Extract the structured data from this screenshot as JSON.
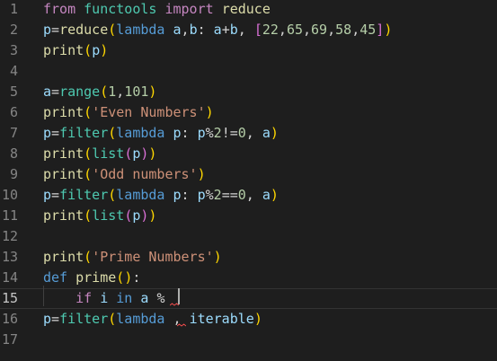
{
  "editor": {
    "colors": {
      "background": "#1e1e1e",
      "line_number": "#858585",
      "keyword": "#569cd6",
      "flow_keyword": "#c586c0",
      "function": "#dcdcaa",
      "string": "#ce9178",
      "number": "#b5cea8",
      "variable": "#9cdcfe",
      "error_squiggle": "#f14c4c"
    },
    "current_line": 15,
    "lines": [
      {
        "number": "1",
        "tokens": [
          {
            "t": "from",
            "c": "flow"
          },
          {
            "t": " ",
            "c": "plain"
          },
          {
            "t": "functools",
            "c": "module"
          },
          {
            "t": " ",
            "c": "plain"
          },
          {
            "t": "import",
            "c": "flow"
          },
          {
            "t": " ",
            "c": "plain"
          },
          {
            "t": "reduce",
            "c": "func"
          }
        ]
      },
      {
        "number": "2",
        "tokens": [
          {
            "t": "p",
            "c": "variable"
          },
          {
            "t": "=",
            "c": "plain"
          },
          {
            "t": "reduce",
            "c": "func"
          },
          {
            "t": "(",
            "c": "bracket1"
          },
          {
            "t": "lambda",
            "c": "keyword"
          },
          {
            "t": " ",
            "c": "plain"
          },
          {
            "t": "a",
            "c": "variable"
          },
          {
            "t": ",",
            "c": "plain"
          },
          {
            "t": "b",
            "c": "variable"
          },
          {
            "t": ": ",
            "c": "plain"
          },
          {
            "t": "a",
            "c": "variable"
          },
          {
            "t": "+",
            "c": "plain"
          },
          {
            "t": "b",
            "c": "variable"
          },
          {
            "t": ", ",
            "c": "plain"
          },
          {
            "t": "[",
            "c": "bracket2"
          },
          {
            "t": "22",
            "c": "number"
          },
          {
            "t": ",",
            "c": "plain"
          },
          {
            "t": "65",
            "c": "number"
          },
          {
            "t": ",",
            "c": "plain"
          },
          {
            "t": "69",
            "c": "number"
          },
          {
            "t": ",",
            "c": "plain"
          },
          {
            "t": "58",
            "c": "number"
          },
          {
            "t": ",",
            "c": "plain"
          },
          {
            "t": "45",
            "c": "number"
          },
          {
            "t": "]",
            "c": "bracket2"
          },
          {
            "t": ")",
            "c": "bracket1"
          }
        ]
      },
      {
        "number": "3",
        "tokens": [
          {
            "t": "print",
            "c": "func"
          },
          {
            "t": "(",
            "c": "bracket1"
          },
          {
            "t": "p",
            "c": "variable"
          },
          {
            "t": ")",
            "c": "bracket1"
          }
        ]
      },
      {
        "number": "4",
        "tokens": []
      },
      {
        "number": "5",
        "tokens": [
          {
            "t": "a",
            "c": "variable"
          },
          {
            "t": "=",
            "c": "plain"
          },
          {
            "t": "range",
            "c": "module"
          },
          {
            "t": "(",
            "c": "bracket1"
          },
          {
            "t": "1",
            "c": "number"
          },
          {
            "t": ",",
            "c": "plain"
          },
          {
            "t": "101",
            "c": "number"
          },
          {
            "t": ")",
            "c": "bracket1"
          }
        ]
      },
      {
        "number": "6",
        "tokens": [
          {
            "t": "print",
            "c": "func"
          },
          {
            "t": "(",
            "c": "bracket1"
          },
          {
            "t": "'Even Numbers'",
            "c": "string"
          },
          {
            "t": ")",
            "c": "bracket1"
          }
        ]
      },
      {
        "number": "7",
        "tokens": [
          {
            "t": "p",
            "c": "variable"
          },
          {
            "t": "=",
            "c": "plain"
          },
          {
            "t": "filter",
            "c": "module"
          },
          {
            "t": "(",
            "c": "bracket1"
          },
          {
            "t": "lambda",
            "c": "keyword"
          },
          {
            "t": " ",
            "c": "plain"
          },
          {
            "t": "p",
            "c": "variable"
          },
          {
            "t": ": ",
            "c": "plain"
          },
          {
            "t": "p",
            "c": "variable"
          },
          {
            "t": "%",
            "c": "plain"
          },
          {
            "t": "2",
            "c": "number"
          },
          {
            "t": "!=",
            "c": "plain"
          },
          {
            "t": "0",
            "c": "number"
          },
          {
            "t": ", ",
            "c": "plain"
          },
          {
            "t": "a",
            "c": "variable"
          },
          {
            "t": ")",
            "c": "bracket1"
          }
        ]
      },
      {
        "number": "8",
        "tokens": [
          {
            "t": "print",
            "c": "func"
          },
          {
            "t": "(",
            "c": "bracket1"
          },
          {
            "t": "list",
            "c": "module"
          },
          {
            "t": "(",
            "c": "bracket2"
          },
          {
            "t": "p",
            "c": "variable"
          },
          {
            "t": ")",
            "c": "bracket2"
          },
          {
            "t": ")",
            "c": "bracket1"
          }
        ]
      },
      {
        "number": "9",
        "tokens": [
          {
            "t": "print",
            "c": "func"
          },
          {
            "t": "(",
            "c": "bracket1"
          },
          {
            "t": "'Odd numbers'",
            "c": "string"
          },
          {
            "t": ")",
            "c": "bracket1"
          }
        ]
      },
      {
        "number": "10",
        "tokens": [
          {
            "t": "p",
            "c": "variable"
          },
          {
            "t": "=",
            "c": "plain"
          },
          {
            "t": "filter",
            "c": "module"
          },
          {
            "t": "(",
            "c": "bracket1"
          },
          {
            "t": "lambda",
            "c": "keyword"
          },
          {
            "t": " ",
            "c": "plain"
          },
          {
            "t": "p",
            "c": "variable"
          },
          {
            "t": ": ",
            "c": "plain"
          },
          {
            "t": "p",
            "c": "variable"
          },
          {
            "t": "%",
            "c": "plain"
          },
          {
            "t": "2",
            "c": "number"
          },
          {
            "t": "==",
            "c": "plain"
          },
          {
            "t": "0",
            "c": "number"
          },
          {
            "t": ", ",
            "c": "plain"
          },
          {
            "t": "a",
            "c": "variable"
          },
          {
            "t": ")",
            "c": "bracket1"
          }
        ]
      },
      {
        "number": "11",
        "tokens": [
          {
            "t": "print",
            "c": "func"
          },
          {
            "t": "(",
            "c": "bracket1"
          },
          {
            "t": "list",
            "c": "module"
          },
          {
            "t": "(",
            "c": "bracket2"
          },
          {
            "t": "p",
            "c": "variable"
          },
          {
            "t": ")",
            "c": "bracket2"
          },
          {
            "t": ")",
            "c": "bracket1"
          }
        ]
      },
      {
        "number": "12",
        "tokens": []
      },
      {
        "number": "13",
        "tokens": [
          {
            "t": "print",
            "c": "func"
          },
          {
            "t": "(",
            "c": "bracket1"
          },
          {
            "t": "'Prime Numbers'",
            "c": "string"
          },
          {
            "t": ")",
            "c": "bracket1"
          }
        ]
      },
      {
        "number": "14",
        "tokens": [
          {
            "t": "def",
            "c": "keyword"
          },
          {
            "t": " ",
            "c": "plain"
          },
          {
            "t": "prime",
            "c": "func"
          },
          {
            "t": "(",
            "c": "bracket1"
          },
          {
            "t": ")",
            "c": "bracket1"
          },
          {
            "t": ":",
            "c": "plain"
          }
        ]
      },
      {
        "number": "15",
        "tokens": [
          {
            "t": "    ",
            "c": "plain"
          },
          {
            "t": "if",
            "c": "flow"
          },
          {
            "t": " ",
            "c": "plain"
          },
          {
            "t": "i",
            "c": "variable"
          },
          {
            "t": " ",
            "c": "plain"
          },
          {
            "t": "in",
            "c": "keyword"
          },
          {
            "t": " ",
            "c": "plain"
          },
          {
            "t": "a",
            "c": "variable"
          },
          {
            "t": " ",
            "c": "plain"
          },
          {
            "t": "%",
            "c": "plain"
          },
          {
            "t": " ",
            "c": "plain"
          }
        ]
      },
      {
        "number": "16",
        "tokens": [
          {
            "t": "p",
            "c": "variable"
          },
          {
            "t": "=",
            "c": "plain"
          },
          {
            "t": "filter",
            "c": "module"
          },
          {
            "t": "(",
            "c": "bracket1"
          },
          {
            "t": "lambda",
            "c": "keyword"
          },
          {
            "t": " ",
            "c": "plain"
          },
          {
            "t": ",",
            "c": "plain"
          },
          {
            "t": " ",
            "c": "plain"
          },
          {
            "t": "iterable",
            "c": "variable"
          },
          {
            "t": ")",
            "c": "bracket1"
          }
        ]
      },
      {
        "number": "17",
        "tokens": []
      }
    ]
  }
}
